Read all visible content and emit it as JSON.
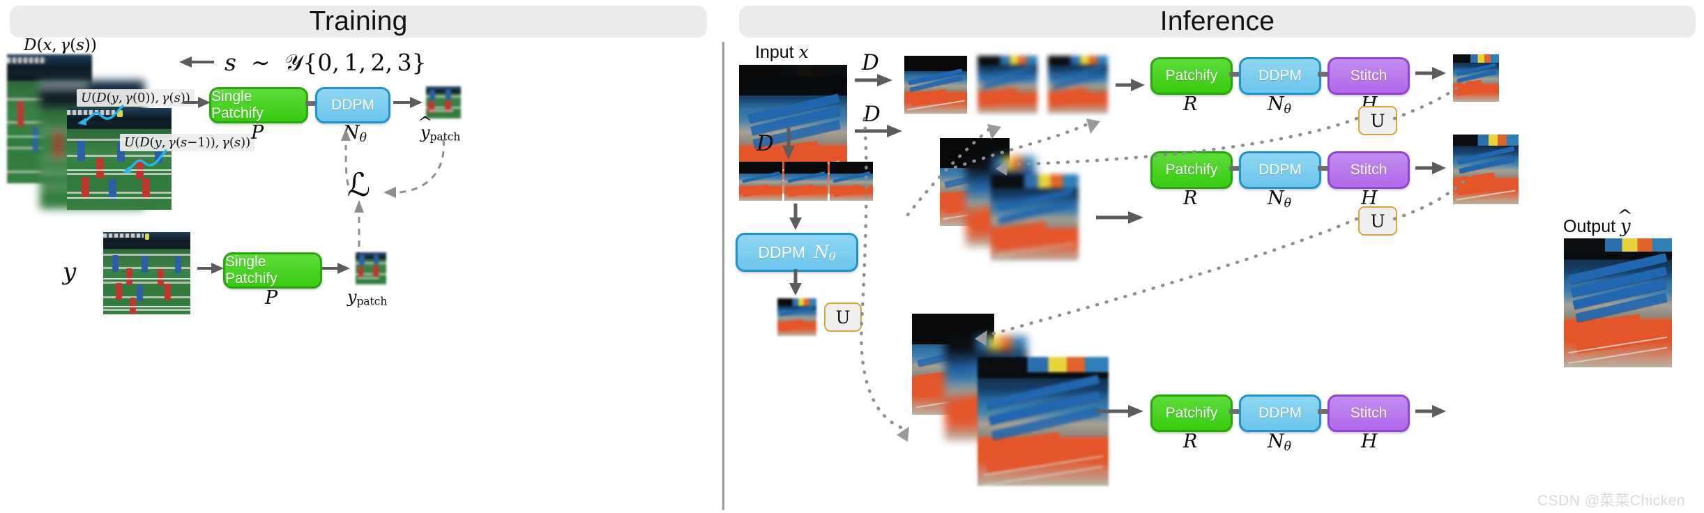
{
  "panels": {
    "training": {
      "title": "Training"
    },
    "inference": {
      "title": "Inference"
    }
  },
  "training": {
    "input_stack_label": "D(x, γ(s))",
    "sampling_label": "s ~ 𝒰{0, 1, 2, 3}",
    "patch_label_top": "U(D(y, γ(0)), γ(s))",
    "patch_label_bottom": "U(D(y, γ(s−1)), γ(s))",
    "blocks": [
      {
        "label": "Single Patchify",
        "symbol": "P",
        "color": "#39cc10"
      },
      {
        "label": "DDPM",
        "symbol": "Nθ",
        "color": "#6cc6ec"
      }
    ],
    "output_label": "ŷ_patch",
    "output_label_base": "y",
    "output_label_sub": "patch",
    "loss_symbol": "ℒ",
    "gt_label": "y",
    "gt_blocks": [
      {
        "label": "Single Patchify",
        "symbol": "P",
        "color": "#39cc10"
      }
    ],
    "gt_output_base": "y",
    "gt_output_sub": "patch"
  },
  "inference": {
    "input_label_prefix": "Input",
    "input_label_var": "x",
    "output_label_prefix": "Output",
    "output_label_var": "ŷ",
    "downsample_symbol": "D",
    "upsample_symbol": "U",
    "ddpm_inline_label": "DDPM",
    "ddpm_inline_symbol": "Nθ",
    "rows": [
      {
        "blocks": [
          {
            "label": "Patchify",
            "symbol": "R",
            "color": "#39cc10"
          },
          {
            "label": "DDPM",
            "symbol": "Nθ",
            "color": "#6cc6ec"
          },
          {
            "label": "Stitch",
            "symbol": "H",
            "color": "#b268ec"
          }
        ]
      },
      {
        "blocks": [
          {
            "label": "Patchify",
            "symbol": "R",
            "color": "#39cc10"
          },
          {
            "label": "DDPM",
            "symbol": "Nθ",
            "color": "#6cc6ec"
          },
          {
            "label": "Stitch",
            "symbol": "H",
            "color": "#b268ec"
          }
        ]
      },
      {
        "blocks": [
          {
            "label": "Patchify",
            "symbol": "R",
            "color": "#39cc10"
          },
          {
            "label": "DDPM",
            "symbol": "Nθ",
            "color": "#6cc6ec"
          },
          {
            "label": "Stitch",
            "symbol": "H",
            "color": "#b268ec"
          }
        ]
      }
    ]
  },
  "watermark": "CSDN @菜菜Chicken",
  "colors": {
    "banner_bg": "#ebebeb",
    "green": "#39cc10",
    "blue": "#6cc6ec",
    "purple": "#b268ec",
    "arrow_grey": "#5c5c5c",
    "dotted_grey": "#8e8e8e",
    "cyan_pointer": "#29b6e8",
    "u_border": "#d8a33a"
  }
}
